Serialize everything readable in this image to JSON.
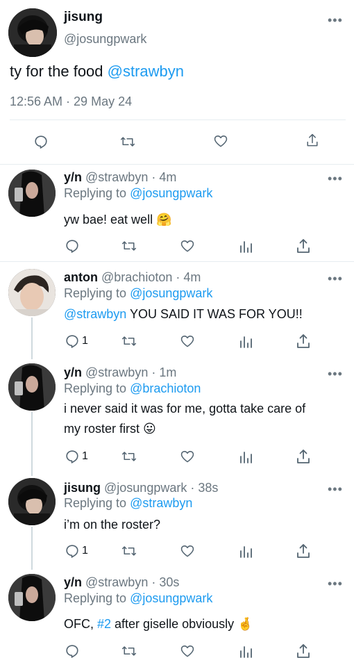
{
  "main_tweet": {
    "name": "jisung",
    "handle": "@josungpwark",
    "text_prefix": "ty for the food ",
    "mention": "@strawbyn",
    "timestamp": "12:56 AM · 29 May 24"
  },
  "replies": [
    {
      "name": "y/n",
      "handle_time": "@strawbyn · 4m",
      "replying_prefix": "Replying to ",
      "replying_to": "@josungpwark",
      "text": "yw bae! eat well",
      "emoji": "🤗",
      "reply_count": ""
    },
    {
      "name": "anton",
      "handle_time": "@brachioton · 4m",
      "replying_prefix": "Replying to ",
      "replying_to": "@josungpwark",
      "mention": "@strawbyn",
      "text": " YOU SAID IT WAS FOR YOU!!",
      "reply_count": "1"
    },
    {
      "name": "y/n",
      "handle_time": "@strawbyn · 1m",
      "replying_prefix": "Replying to ",
      "replying_to": "@brachioton",
      "text_line1": "i never said it was for me, gotta take care of",
      "text_line2": "my roster first",
      "emoji": "😛",
      "reply_count": "1"
    },
    {
      "name": "jisung",
      "handle_time": "@josungpwark · 38s",
      "replying_prefix": "Replying to ",
      "replying_to": "@strawbyn",
      "text": "i’m on the roster?",
      "reply_count": "1"
    },
    {
      "name": "y/n",
      "handle_time": "@strawbyn · 30s",
      "replying_prefix": "Replying to ",
      "replying_to": "@josungpwark",
      "text_prefix": "OFC, ",
      "hashtag": "#2",
      "text_suffix": " after giselle obviously",
      "emoji": "🤞",
      "reply_count": ""
    }
  ],
  "icons": [
    "reply-icon",
    "retweet-icon",
    "like-icon",
    "analytics-icon",
    "share-icon",
    "more-icon"
  ],
  "colors": {
    "link": "#1d9bf0",
    "secondary": "#6b7780",
    "divider": "#e6ecf0",
    "thread_line": "#cfd9de"
  }
}
